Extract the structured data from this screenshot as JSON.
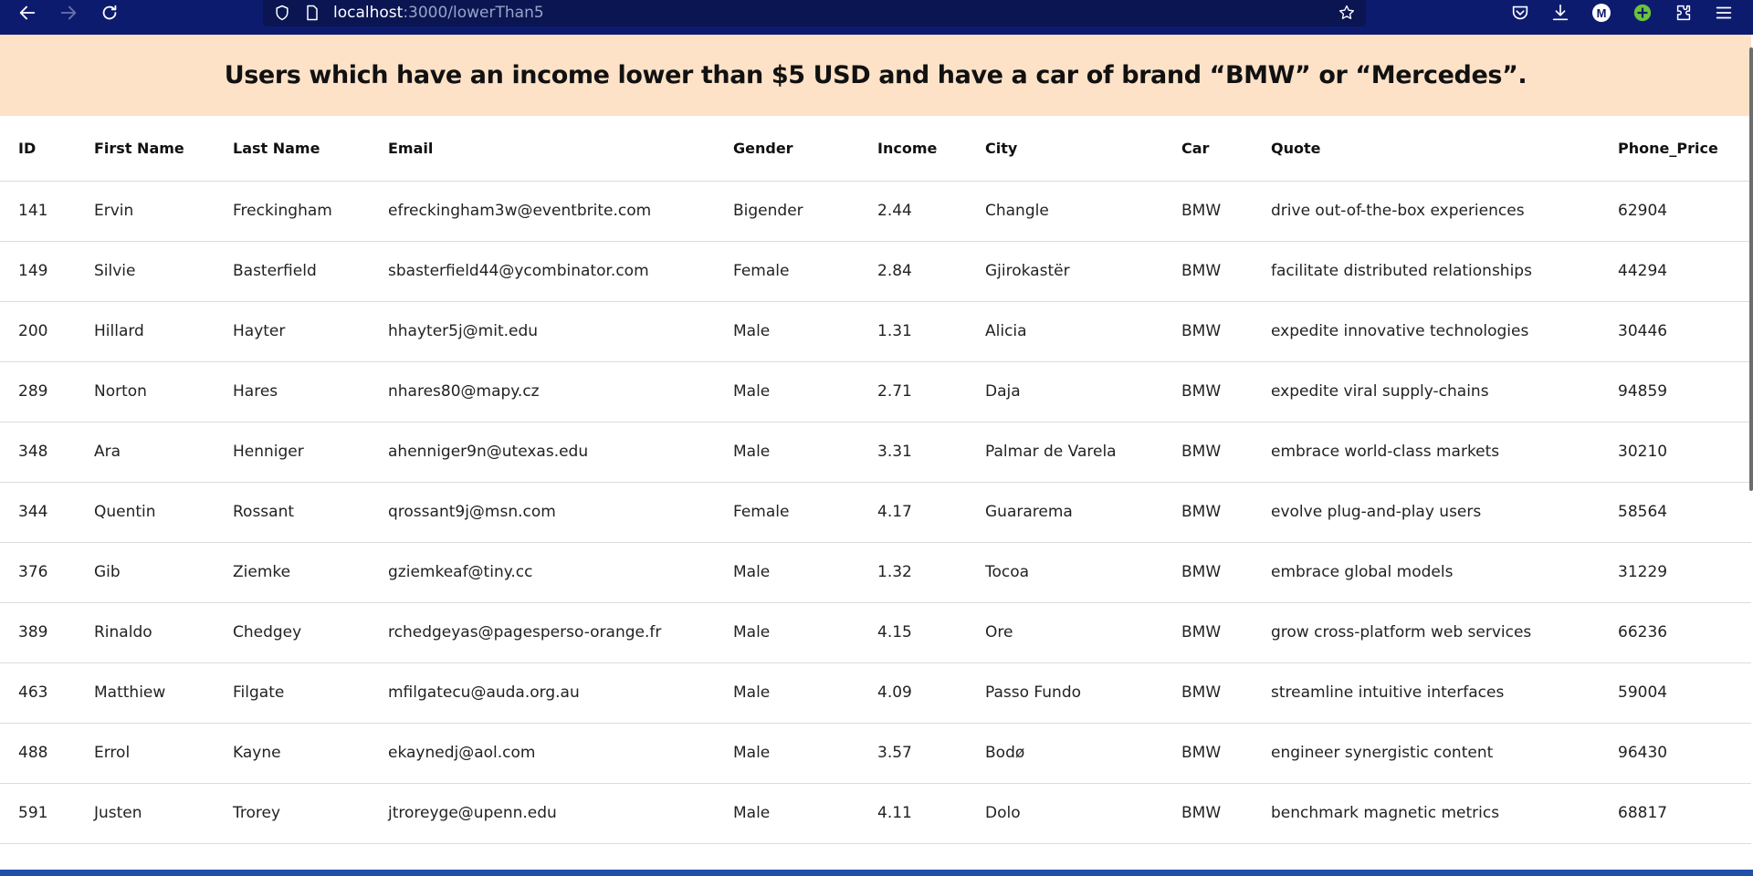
{
  "browser": {
    "url_host": "localhost",
    "url_path": ":3000/lowerThan5",
    "profile_initial": "M"
  },
  "page": {
    "title": "Users which have an income lower than $5 USD and have a car of brand “BMW” or “Mercedes”."
  },
  "table": {
    "columns": [
      "ID",
      "First Name",
      "Last Name",
      "Email",
      "Gender",
      "Income",
      "City",
      "Car",
      "Quote",
      "Phone_Price"
    ],
    "rows": [
      [
        "141",
        "Ervin",
        "Freckingham",
        "efreckingham3w@eventbrite.com",
        "Bigender",
        "2.44",
        "Changle",
        "BMW",
        "drive out-of-the-box experiences",
        "62904"
      ],
      [
        "149",
        "Silvie",
        "Basterfield",
        "sbasterfield44@ycombinator.com",
        "Female",
        "2.84",
        "Gjirokastër",
        "BMW",
        "facilitate distributed relationships",
        "44294"
      ],
      [
        "200",
        "Hillard",
        "Hayter",
        "hhayter5j@mit.edu",
        "Male",
        "1.31",
        "Alicia",
        "BMW",
        "expedite innovative technologies",
        "30446"
      ],
      [
        "289",
        "Norton",
        "Hares",
        "nhares80@mapy.cz",
        "Male",
        "2.71",
        "Daja",
        "BMW",
        "expedite viral supply-chains",
        "94859"
      ],
      [
        "348",
        "Ara",
        "Henniger",
        "ahenniger9n@utexas.edu",
        "Male",
        "3.31",
        "Palmar de Varela",
        "BMW",
        "embrace world-class markets",
        "30210"
      ],
      [
        "344",
        "Quentin",
        "Rossant",
        "qrossant9j@msn.com",
        "Female",
        "4.17",
        "Guararema",
        "BMW",
        "evolve plug-and-play users",
        "58564"
      ],
      [
        "376",
        "Gib",
        "Ziemke",
        "gziemkeaf@tiny.cc",
        "Male",
        "1.32",
        "Tocoa",
        "BMW",
        "embrace global models",
        "31229"
      ],
      [
        "389",
        "Rinaldo",
        "Chedgey",
        "rchedgeyas@pagesperso-orange.fr",
        "Male",
        "4.15",
        "Ore",
        "BMW",
        "grow cross-platform web services",
        "66236"
      ],
      [
        "463",
        "Matthiew",
        "Filgate",
        "mfilgatecu@auda.org.au",
        "Male",
        "4.09",
        "Passo Fundo",
        "BMW",
        "streamline intuitive interfaces",
        "59004"
      ],
      [
        "488",
        "Errol",
        "Kayne",
        "ekaynedj@aol.com",
        "Male",
        "3.57",
        "Bodø",
        "BMW",
        "engineer synergistic content",
        "96430"
      ],
      [
        "591",
        "Justen",
        "Trorey",
        "jtroreyge@upenn.edu",
        "Male",
        "4.11",
        "Dolo",
        "BMW",
        "benchmark magnetic metrics",
        "68817"
      ]
    ]
  }
}
